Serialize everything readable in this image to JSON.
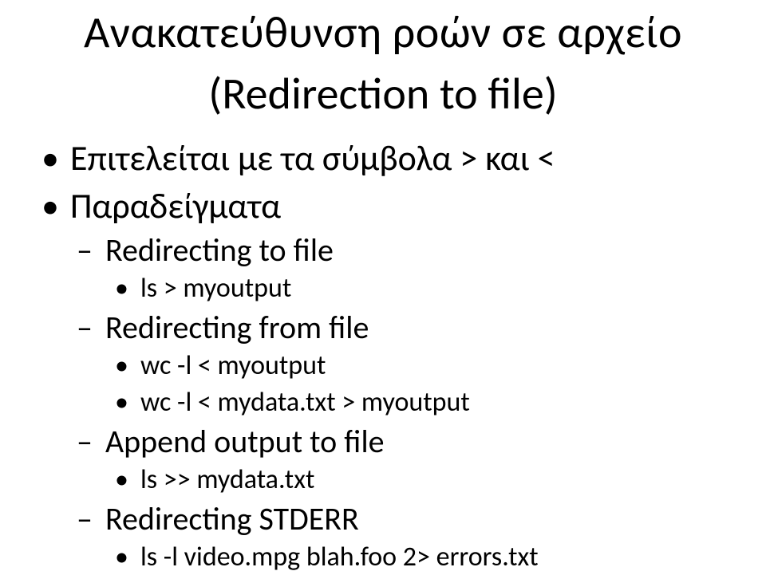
{
  "title": "Ανακατεύθυνση ροών σε αρχείο",
  "subtitle": "(Redirection to file)",
  "bullets": {
    "b1": "Επιτελείται με τα σύμβολα > και <",
    "b2": "Παραδείγματα",
    "b2a": "Redirecting to file",
    "b2a1": "ls > myoutput",
    "b2b": "Redirecting from file",
    "b2b1": "wc -l < myoutput",
    "b2b2": "wc -l < mydata.txt > myoutput",
    "b2c": "Append output to file",
    "b2c1": "ls  >> mydata.txt",
    "b2d": "Redirecting STDERR",
    "b2d1": "ls -l video.mpg blah.foo 2> errors.txt"
  }
}
